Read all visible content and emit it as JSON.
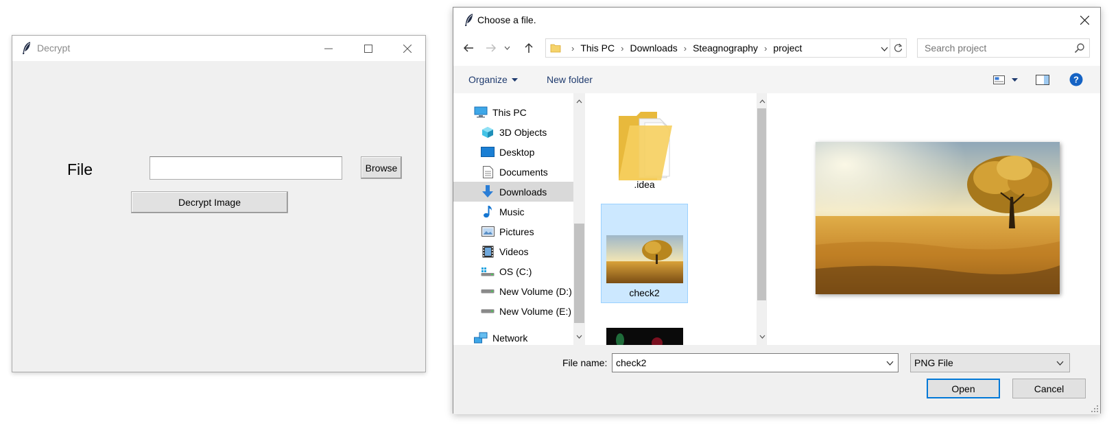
{
  "decrypt_window": {
    "title": "Decrypt",
    "file_label": "File",
    "file_value": "",
    "browse_label": "Browse",
    "decrypt_label": "Decrypt Image"
  },
  "dialog": {
    "title": "Choose a file.",
    "breadcrumbs": [
      "This PC",
      "Downloads",
      "Steagnography",
      "project"
    ],
    "search_placeholder": "Search project",
    "toolbar": {
      "organize_label": "Organize",
      "new_folder_label": "New folder"
    },
    "nav_items": [
      {
        "label": "This PC",
        "icon": "monitor-icon",
        "level": 0,
        "selected": false
      },
      {
        "label": "3D Objects",
        "icon": "cube-icon",
        "level": 1,
        "selected": false
      },
      {
        "label": "Desktop",
        "icon": "desktop-icon",
        "level": 1,
        "selected": false
      },
      {
        "label": "Documents",
        "icon": "document-icon",
        "level": 1,
        "selected": false
      },
      {
        "label": "Downloads",
        "icon": "download-arrow-icon",
        "level": 1,
        "selected": true
      },
      {
        "label": "Music",
        "icon": "music-note-icon",
        "level": 1,
        "selected": false
      },
      {
        "label": "Pictures",
        "icon": "picture-icon",
        "level": 1,
        "selected": false
      },
      {
        "label": "Videos",
        "icon": "film-icon",
        "level": 1,
        "selected": false
      },
      {
        "label": "OS (C:)",
        "icon": "drive-os-icon",
        "level": 1,
        "selected": false
      },
      {
        "label": "New Volume (D:)",
        "icon": "drive-icon",
        "level": 1,
        "selected": false
      },
      {
        "label": "New Volume (E:)",
        "icon": "drive-icon",
        "level": 1,
        "selected": false
      },
      {
        "label": "Network",
        "icon": "network-icon",
        "level": 0,
        "selected": false
      }
    ],
    "files": [
      {
        "name": ".idea",
        "kind": "folder",
        "selected": false
      },
      {
        "name": "check2",
        "kind": "image",
        "selected": true
      },
      {
        "name": "",
        "kind": "image-dark",
        "selected": false
      }
    ],
    "file_name_label": "File name:",
    "file_name_value": "check2",
    "file_type_value": "PNG File",
    "open_label": "Open",
    "cancel_label": "Cancel"
  },
  "colors": {
    "accent": "#0078d7",
    "selection_bg": "#cce8ff",
    "nav_selected_bg": "#d9d9d9",
    "help_blue": "#1563c4"
  }
}
